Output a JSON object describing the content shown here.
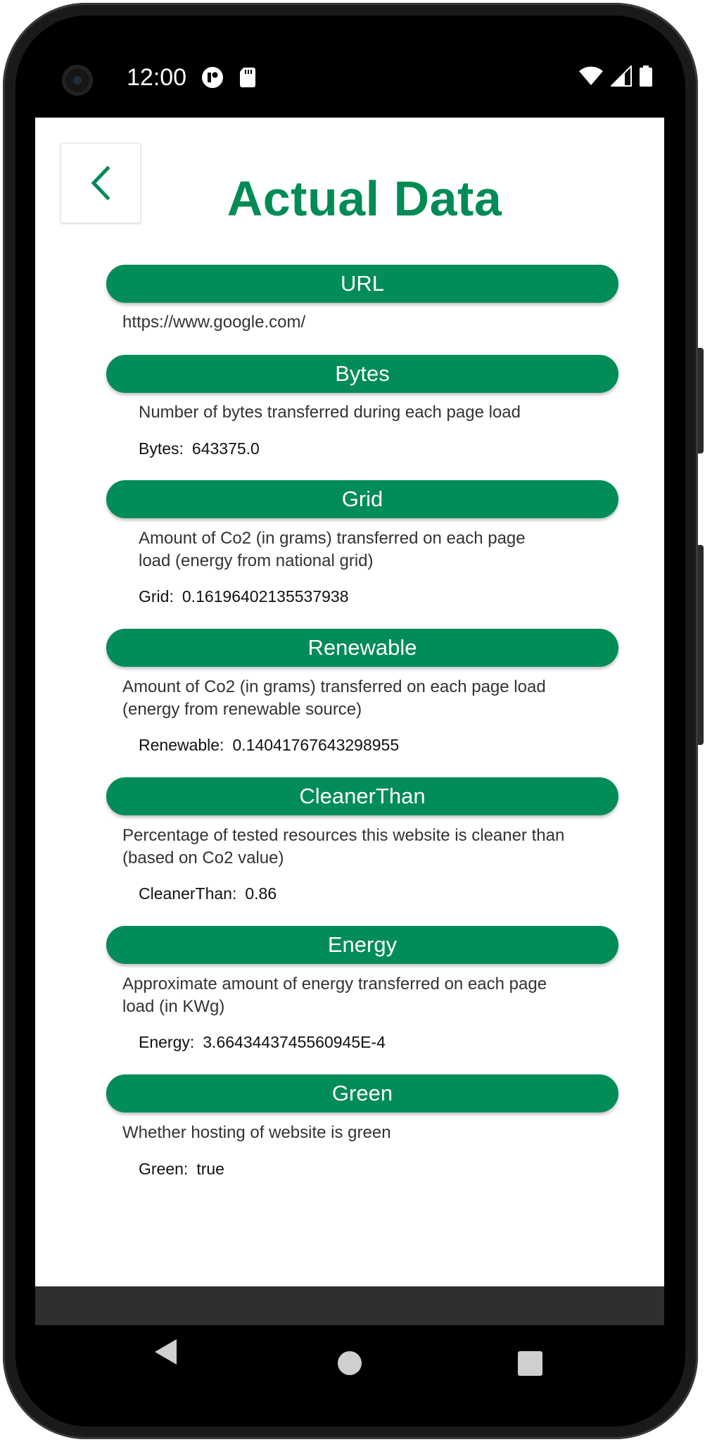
{
  "status": {
    "time": "12:00"
  },
  "header": {
    "title": "Actual Data"
  },
  "sections": [
    {
      "title": "URL",
      "description": "https://www.google.com/",
      "label": "",
      "value": ""
    },
    {
      "title": "Bytes",
      "description": "Number of bytes transferred during each page load",
      "label": "Bytes:",
      "value": "643375.0"
    },
    {
      "title": "Grid",
      "description_lines": [
        "Amount of Co2 (in grams) transferred on each page",
        "load (energy from national grid)"
      ],
      "label": "Grid:",
      "value": "0.16196402135537938"
    },
    {
      "title": "Renewable",
      "description_lines": [
        "Amount of Co2 (in grams) transferred on each page load",
        "(energy from renewable source)"
      ],
      "label": "Renewable:",
      "value": "0.14041767643298955"
    },
    {
      "title": "CleanerThan",
      "description_lines": [
        "Percentage of tested resources this website is cleaner than",
        "(based on Co2 value)"
      ],
      "label": "CleanerThan:",
      "value": "0.86"
    },
    {
      "title": "Energy",
      "description_lines": [
        "Approximate amount of energy transferred on each page",
        "load (in KWg)"
      ],
      "label": "Energy:",
      "value": "3.6643443745560945E-4"
    },
    {
      "title": "Green",
      "description": "Whether hosting of website is green",
      "label": "Green:",
      "value": "true"
    }
  ],
  "colors": {
    "accent": "#018c58",
    "title": "#008b55"
  }
}
